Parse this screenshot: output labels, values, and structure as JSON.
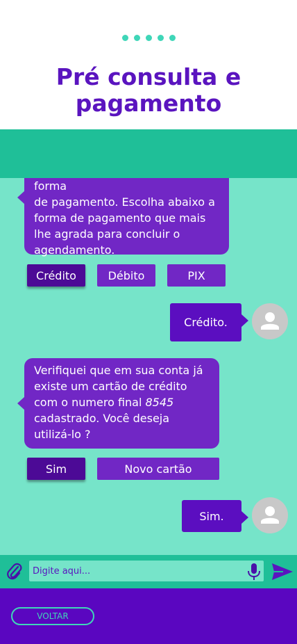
{
  "header": {
    "title_line1": "Pré consulta e",
    "title_line2": "pagamento",
    "progress_dots": 5
  },
  "chat": {
    "message1": {
      "cut_line": "Agora vamos prosseguir com a forma",
      "line1": "de pagamento. Escolha abaixo a",
      "line2": "forma de pagamento que mais",
      "line3": "lhe agrada para concluir o",
      "line4": "agendamento."
    },
    "payment_options": {
      "credit": "Crédito",
      "debit": "Débito",
      "pix": "PIX",
      "selected": "Crédito"
    },
    "reply1": "Crédito.",
    "message2": {
      "line1": "Verifiquei que em sua conta já",
      "line2": "existe um cartão de crédito",
      "line3_prefix": "com o numero final ",
      "line3_number": "8545",
      "line4": "cadastrado. Você deseja",
      "line5": "utilizá-lo ?"
    },
    "card_options": {
      "yes": "Sim",
      "new_card": "Novo cartão",
      "selected": "Sim"
    },
    "reply2": "Sim."
  },
  "input": {
    "placeholder": "Digite aqui..."
  },
  "footer": {
    "back_label": "VOLTAR"
  },
  "colors": {
    "brand_purple": "#5a14bf",
    "teal": "#1fbf98",
    "light_teal": "#76e4c9",
    "bubble_purple": "#7127c5",
    "accent_teal": "#3fd6b8"
  },
  "icons": {
    "attach": "paperclip-icon",
    "mic": "microphone-icon",
    "send": "send-icon",
    "avatar": "user-avatar-icon"
  }
}
